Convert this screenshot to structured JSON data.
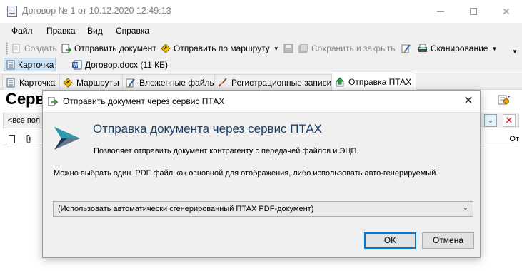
{
  "window": {
    "title": "Договор № 1 от 10.12.2020 12:49:13"
  },
  "menu": {
    "items": [
      "Файл",
      "Правка",
      "Вид",
      "Справка"
    ]
  },
  "toolbar": {
    "create": "Создать",
    "send_document": "Отправить документ",
    "send_by_route": "Отправить по маршруту",
    "save_and_close": "Сохранить и закрыть",
    "scanning": "Сканирование"
  },
  "filebar": {
    "card": "Карточка",
    "file": "Договор.docx (11 КБ)"
  },
  "tabs": [
    {
      "label": "Карточка"
    },
    {
      "label": "Маршруты"
    },
    {
      "label": "Вложенные файлы"
    },
    {
      "label": "Регистрационные записи"
    },
    {
      "label": "Отправка ПТАХ"
    }
  ],
  "content": {
    "heading": "Серв",
    "filter_label": "<все пол",
    "right_col": "От"
  },
  "dialog": {
    "title": "Отправить документ через сервис ПТАХ",
    "heading": "Отправка документа через сервис ПТАХ",
    "subtitle": "Позволяет отправить документ контрагенту с передачей файлов и ЭЦП.",
    "hint": "Можно выбрать один .PDF файл как основной для отображения, либо использовать авто-генерируемый.",
    "select_value": "(Использовать автоматически сгенерированный ПТАХ PDF-документ)",
    "ok_label": "OK",
    "cancel_label": "Отмена"
  },
  "colors": {
    "accent": "#0078d7",
    "logo_teal": "#2a9bb0",
    "logo_dark": "#1d3557",
    "close_red": "#d00000"
  }
}
